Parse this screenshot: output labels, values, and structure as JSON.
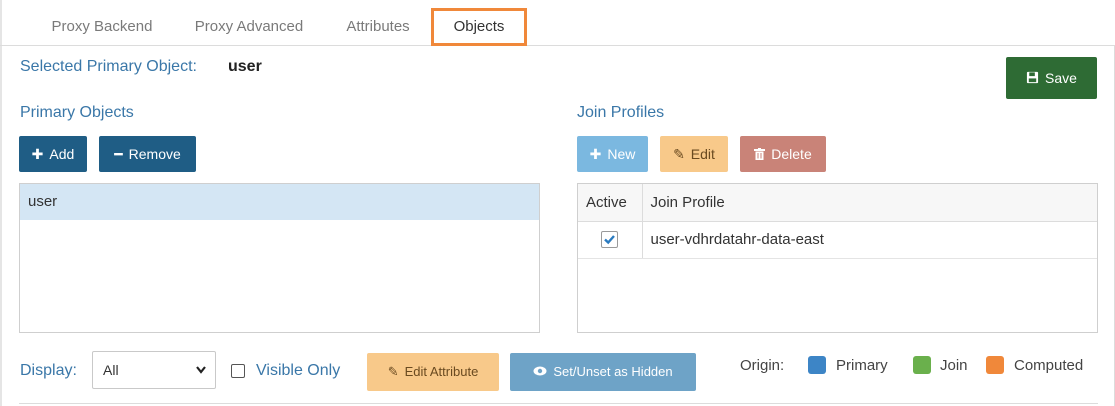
{
  "tabs": [
    {
      "label": "Proxy Backend"
    },
    {
      "label": "Proxy Advanced"
    },
    {
      "label": "Attributes"
    },
    {
      "label": "Objects"
    }
  ],
  "selected": {
    "label": "Selected Primary Object:",
    "value": "user"
  },
  "save": {
    "label": "Save",
    "icon": "floppy-disk-icon"
  },
  "primary_objects": {
    "title": "Primary Objects",
    "add_label": "Add",
    "remove_label": "Remove",
    "items": [
      "user"
    ]
  },
  "join_profiles": {
    "title": "Join Profiles",
    "new_label": "New",
    "edit_label": "Edit",
    "delete_label": "Delete",
    "columns": [
      "Active",
      "Join Profile"
    ],
    "rows": [
      {
        "active": true,
        "name": "user-vdhrdatahr-data-east"
      }
    ]
  },
  "footer": {
    "display_label": "Display:",
    "display_value": "All",
    "visible_only_label": "Visible Only",
    "edit_attribute_label": "Edit Attribute",
    "set_hidden_label": "Set/Unset as Hidden",
    "origin_label": "Origin:",
    "legend": [
      {
        "label": "Primary",
        "color": "#3d85c6"
      },
      {
        "label": "Join",
        "color": "#6ab04c"
      },
      {
        "label": "Computed",
        "color": "#f0883a"
      }
    ]
  },
  "colors": {
    "accent": "#3a77a8",
    "active_tab_border": "#f0883a",
    "save": "#2e6b34"
  }
}
